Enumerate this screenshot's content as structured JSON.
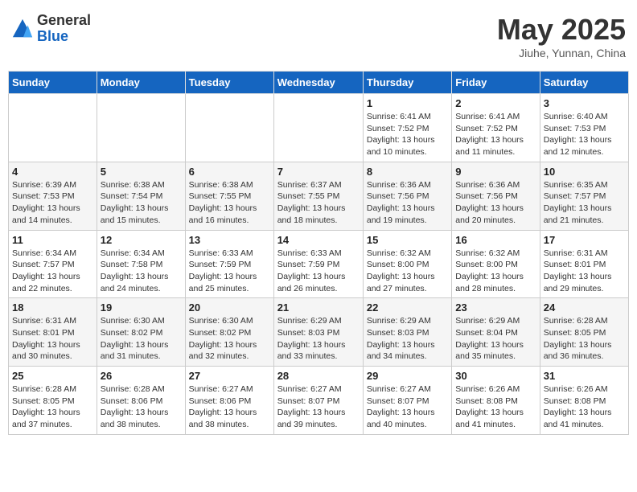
{
  "header": {
    "logo_general": "General",
    "logo_blue": "Blue",
    "title": "May 2025",
    "location": "Jiuhe, Yunnan, China"
  },
  "weekdays": [
    "Sunday",
    "Monday",
    "Tuesday",
    "Wednesday",
    "Thursday",
    "Friday",
    "Saturday"
  ],
  "weeks": [
    [
      {
        "day": "",
        "info": ""
      },
      {
        "day": "",
        "info": ""
      },
      {
        "day": "",
        "info": ""
      },
      {
        "day": "",
        "info": ""
      },
      {
        "day": "1",
        "info": "Sunrise: 6:41 AM\nSunset: 7:52 PM\nDaylight: 13 hours\nand 10 minutes."
      },
      {
        "day": "2",
        "info": "Sunrise: 6:41 AM\nSunset: 7:52 PM\nDaylight: 13 hours\nand 11 minutes."
      },
      {
        "day": "3",
        "info": "Sunrise: 6:40 AM\nSunset: 7:53 PM\nDaylight: 13 hours\nand 12 minutes."
      }
    ],
    [
      {
        "day": "4",
        "info": "Sunrise: 6:39 AM\nSunset: 7:53 PM\nDaylight: 13 hours\nand 14 minutes."
      },
      {
        "day": "5",
        "info": "Sunrise: 6:38 AM\nSunset: 7:54 PM\nDaylight: 13 hours\nand 15 minutes."
      },
      {
        "day": "6",
        "info": "Sunrise: 6:38 AM\nSunset: 7:55 PM\nDaylight: 13 hours\nand 16 minutes."
      },
      {
        "day": "7",
        "info": "Sunrise: 6:37 AM\nSunset: 7:55 PM\nDaylight: 13 hours\nand 18 minutes."
      },
      {
        "day": "8",
        "info": "Sunrise: 6:36 AM\nSunset: 7:56 PM\nDaylight: 13 hours\nand 19 minutes."
      },
      {
        "day": "9",
        "info": "Sunrise: 6:36 AM\nSunset: 7:56 PM\nDaylight: 13 hours\nand 20 minutes."
      },
      {
        "day": "10",
        "info": "Sunrise: 6:35 AM\nSunset: 7:57 PM\nDaylight: 13 hours\nand 21 minutes."
      }
    ],
    [
      {
        "day": "11",
        "info": "Sunrise: 6:34 AM\nSunset: 7:57 PM\nDaylight: 13 hours\nand 22 minutes."
      },
      {
        "day": "12",
        "info": "Sunrise: 6:34 AM\nSunset: 7:58 PM\nDaylight: 13 hours\nand 24 minutes."
      },
      {
        "day": "13",
        "info": "Sunrise: 6:33 AM\nSunset: 7:59 PM\nDaylight: 13 hours\nand 25 minutes."
      },
      {
        "day": "14",
        "info": "Sunrise: 6:33 AM\nSunset: 7:59 PM\nDaylight: 13 hours\nand 26 minutes."
      },
      {
        "day": "15",
        "info": "Sunrise: 6:32 AM\nSunset: 8:00 PM\nDaylight: 13 hours\nand 27 minutes."
      },
      {
        "day": "16",
        "info": "Sunrise: 6:32 AM\nSunset: 8:00 PM\nDaylight: 13 hours\nand 28 minutes."
      },
      {
        "day": "17",
        "info": "Sunrise: 6:31 AM\nSunset: 8:01 PM\nDaylight: 13 hours\nand 29 minutes."
      }
    ],
    [
      {
        "day": "18",
        "info": "Sunrise: 6:31 AM\nSunset: 8:01 PM\nDaylight: 13 hours\nand 30 minutes."
      },
      {
        "day": "19",
        "info": "Sunrise: 6:30 AM\nSunset: 8:02 PM\nDaylight: 13 hours\nand 31 minutes."
      },
      {
        "day": "20",
        "info": "Sunrise: 6:30 AM\nSunset: 8:02 PM\nDaylight: 13 hours\nand 32 minutes."
      },
      {
        "day": "21",
        "info": "Sunrise: 6:29 AM\nSunset: 8:03 PM\nDaylight: 13 hours\nand 33 minutes."
      },
      {
        "day": "22",
        "info": "Sunrise: 6:29 AM\nSunset: 8:03 PM\nDaylight: 13 hours\nand 34 minutes."
      },
      {
        "day": "23",
        "info": "Sunrise: 6:29 AM\nSunset: 8:04 PM\nDaylight: 13 hours\nand 35 minutes."
      },
      {
        "day": "24",
        "info": "Sunrise: 6:28 AM\nSunset: 8:05 PM\nDaylight: 13 hours\nand 36 minutes."
      }
    ],
    [
      {
        "day": "25",
        "info": "Sunrise: 6:28 AM\nSunset: 8:05 PM\nDaylight: 13 hours\nand 37 minutes."
      },
      {
        "day": "26",
        "info": "Sunrise: 6:28 AM\nSunset: 8:06 PM\nDaylight: 13 hours\nand 38 minutes."
      },
      {
        "day": "27",
        "info": "Sunrise: 6:27 AM\nSunset: 8:06 PM\nDaylight: 13 hours\nand 38 minutes."
      },
      {
        "day": "28",
        "info": "Sunrise: 6:27 AM\nSunset: 8:07 PM\nDaylight: 13 hours\nand 39 minutes."
      },
      {
        "day": "29",
        "info": "Sunrise: 6:27 AM\nSunset: 8:07 PM\nDaylight: 13 hours\nand 40 minutes."
      },
      {
        "day": "30",
        "info": "Sunrise: 6:26 AM\nSunset: 8:08 PM\nDaylight: 13 hours\nand 41 minutes."
      },
      {
        "day": "31",
        "info": "Sunrise: 6:26 AM\nSunset: 8:08 PM\nDaylight: 13 hours\nand 41 minutes."
      }
    ]
  ]
}
